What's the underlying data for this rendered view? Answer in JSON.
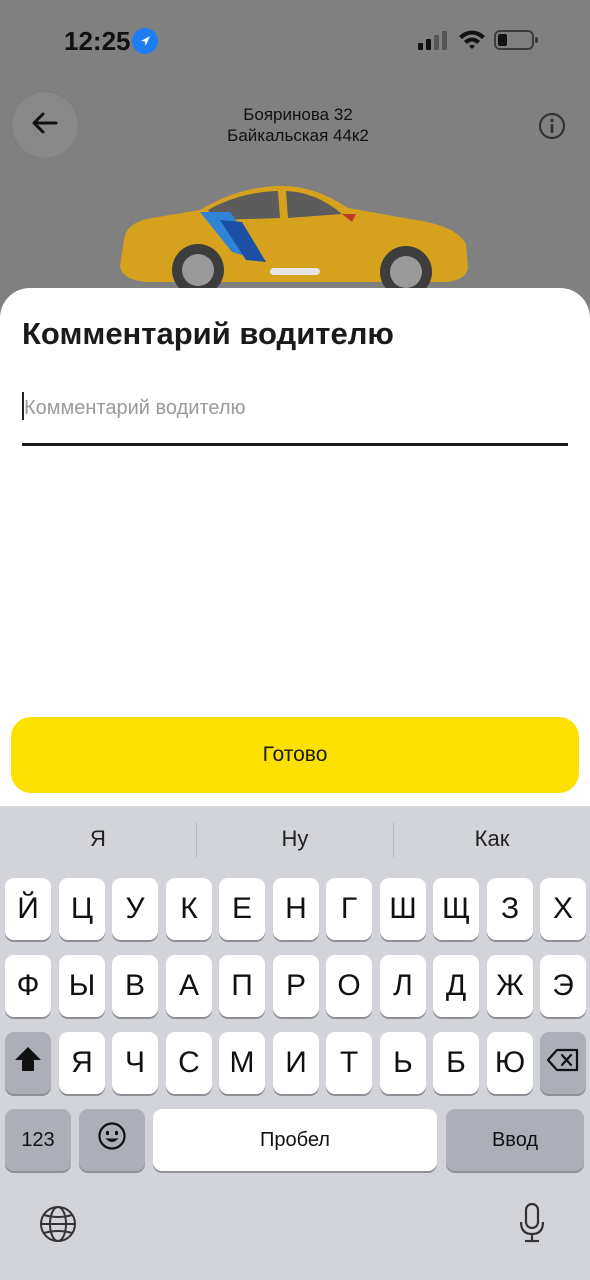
{
  "status_bar": {
    "time": "12:25"
  },
  "header": {
    "route_from": "Бояринова 32",
    "route_to": "Байкальская 44к2"
  },
  "sheet": {
    "title": "Комментарий водителю",
    "comment_value": "",
    "comment_placeholder": "Комментарий водителю",
    "done_label": "Готово"
  },
  "keyboard": {
    "suggestions": [
      "Я",
      "Ну",
      "Как"
    ],
    "row1": [
      "Й",
      "Ц",
      "У",
      "К",
      "Е",
      "Н",
      "Г",
      "Ш",
      "Щ",
      "З",
      "Х"
    ],
    "row2": [
      "Ф",
      "Ы",
      "В",
      "А",
      "П",
      "Р",
      "О",
      "Л",
      "Д",
      "Ж",
      "Э"
    ],
    "row3": [
      "Я",
      "Ч",
      "С",
      "М",
      "И",
      "Т",
      "Ь",
      "Б",
      "Ю"
    ],
    "numbers_key": "123",
    "space_key": "Пробел",
    "return_key": "Ввод"
  },
  "colors": {
    "accent": "#fce000",
    "location_blue": "#1e7df2",
    "car_yellow": "#d6a21e",
    "keyboard_bg": "#d2d4da"
  },
  "icons": [
    "location-arrow-icon",
    "signal-icon",
    "wifi-icon",
    "battery-icon",
    "back-arrow-icon",
    "info-icon",
    "shift-icon",
    "backspace-icon",
    "emoji-icon",
    "globe-icon",
    "microphone-icon"
  ]
}
